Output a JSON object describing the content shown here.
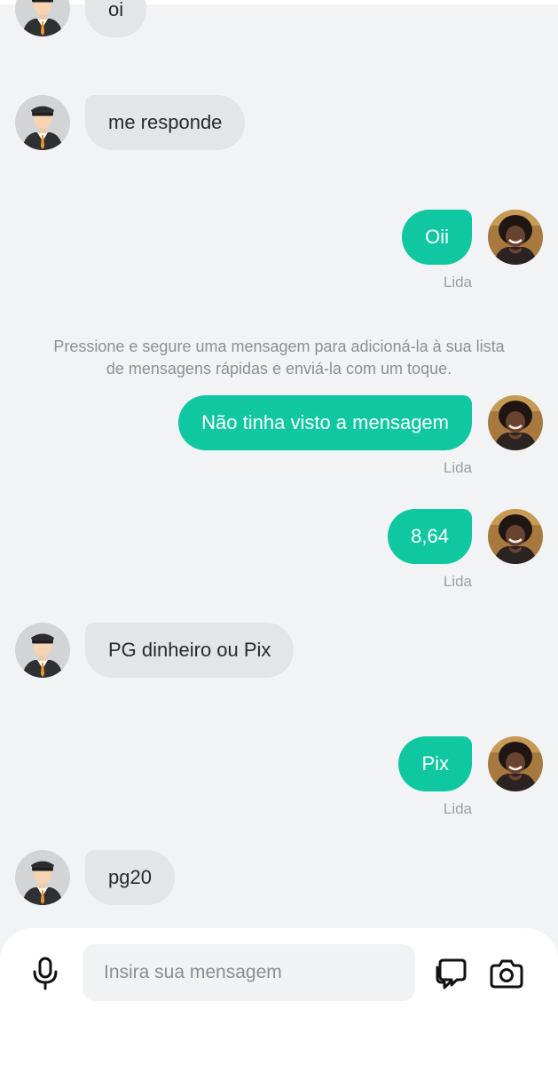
{
  "messages": [
    {
      "id": "m1",
      "side": "in",
      "text": "oi"
    },
    {
      "id": "m2",
      "side": "in",
      "text": "me responde"
    },
    {
      "id": "m3",
      "side": "out",
      "text": "Oii",
      "status": "Lida"
    },
    {
      "id": "m4",
      "side": "out",
      "text": "Não tinha visto a mensagem",
      "status": "Lida"
    },
    {
      "id": "m5",
      "side": "out",
      "text": "8,64",
      "status": "Lida"
    },
    {
      "id": "m6",
      "side": "in",
      "text": "PG dinheiro ou Pix"
    },
    {
      "id": "m7",
      "side": "out",
      "text": "Pix",
      "status": "Lida"
    },
    {
      "id": "m8",
      "side": "in",
      "text": "pg20"
    }
  ],
  "hint": {
    "line1": "Pressione e segure uma mensagem para adicioná-la à sua lista",
    "line2": "de mensagens rápidas e enviá-la com um toque."
  },
  "composer": {
    "placeholder": "Insira sua mensagem",
    "value": "",
    "icons": {
      "left": "microphone-icon",
      "right1": "quick-messages-icon",
      "right2": "camera-icon"
    }
  },
  "colors": {
    "background": "#f2f3f5",
    "outgoing_bubble": "#0fc7a0",
    "incoming_bubble": "#e4e5e9",
    "status_text": "#9aa0a6"
  }
}
